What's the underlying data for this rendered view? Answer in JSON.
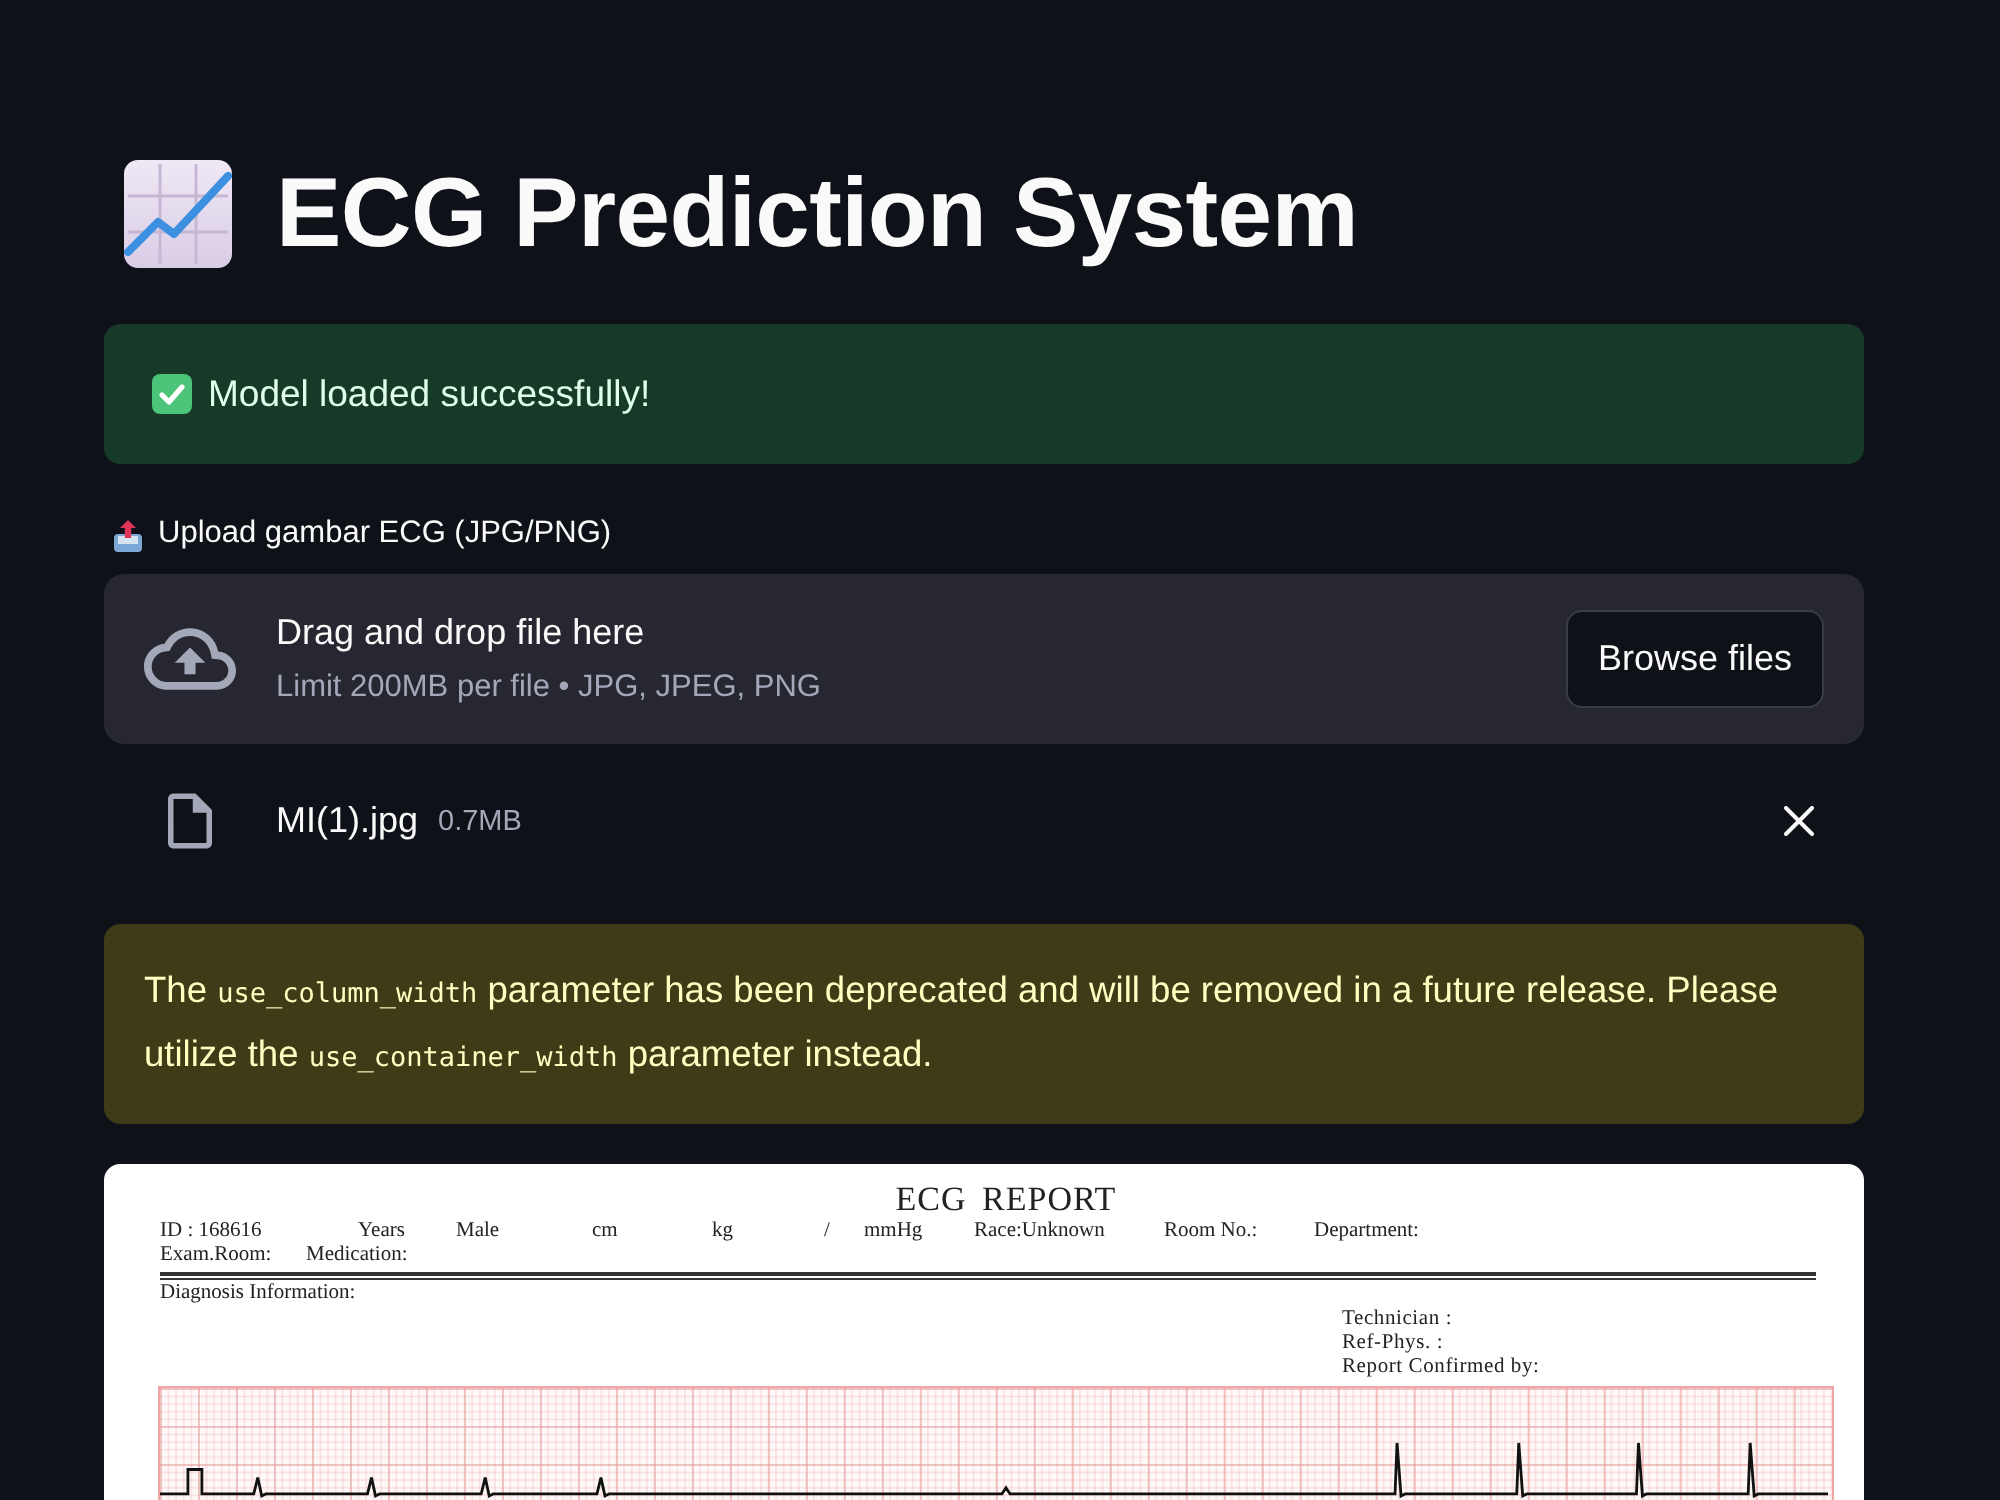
{
  "page": {
    "title": "ECG Prediction System"
  },
  "success_alert": {
    "message": "Model loaded successfully!"
  },
  "file_uploader": {
    "label": "Upload gambar ECG (JPG/PNG)",
    "dropzone": {
      "instruction": "Drag and drop file here",
      "limits": "Limit 200MB per file • JPG, JPEG, PNG",
      "button": "Browse files"
    },
    "files": [
      {
        "name": "MI(1).jpg",
        "size": "0.7MB"
      }
    ]
  },
  "warning_alert": {
    "segments": [
      {
        "kind": "text",
        "text": "The "
      },
      {
        "kind": "code",
        "text": "use_column_width"
      },
      {
        "kind": "text",
        "text": " parameter has been deprecated and will be removed in a future release. Please utilize the "
      },
      {
        "kind": "code",
        "text": "use_container_width"
      },
      {
        "kind": "text",
        "text": " parameter instead."
      }
    ]
  },
  "ecg_image": {
    "title": "ECG REPORT",
    "patient_fields": [
      "ID : 168616",
      "Years",
      "Male",
      "cm",
      "kg",
      "/",
      "mmHg",
      "Race:Unknown",
      "Room No.:",
      "Department:"
    ],
    "exam_fields": [
      "Exam.Room:",
      "Medication:"
    ],
    "diagnosis_label": "Diagnosis Information:",
    "signature_fields": [
      "Technician :",
      "Ref-Phys. :",
      "Report Confirmed by:"
    ]
  }
}
